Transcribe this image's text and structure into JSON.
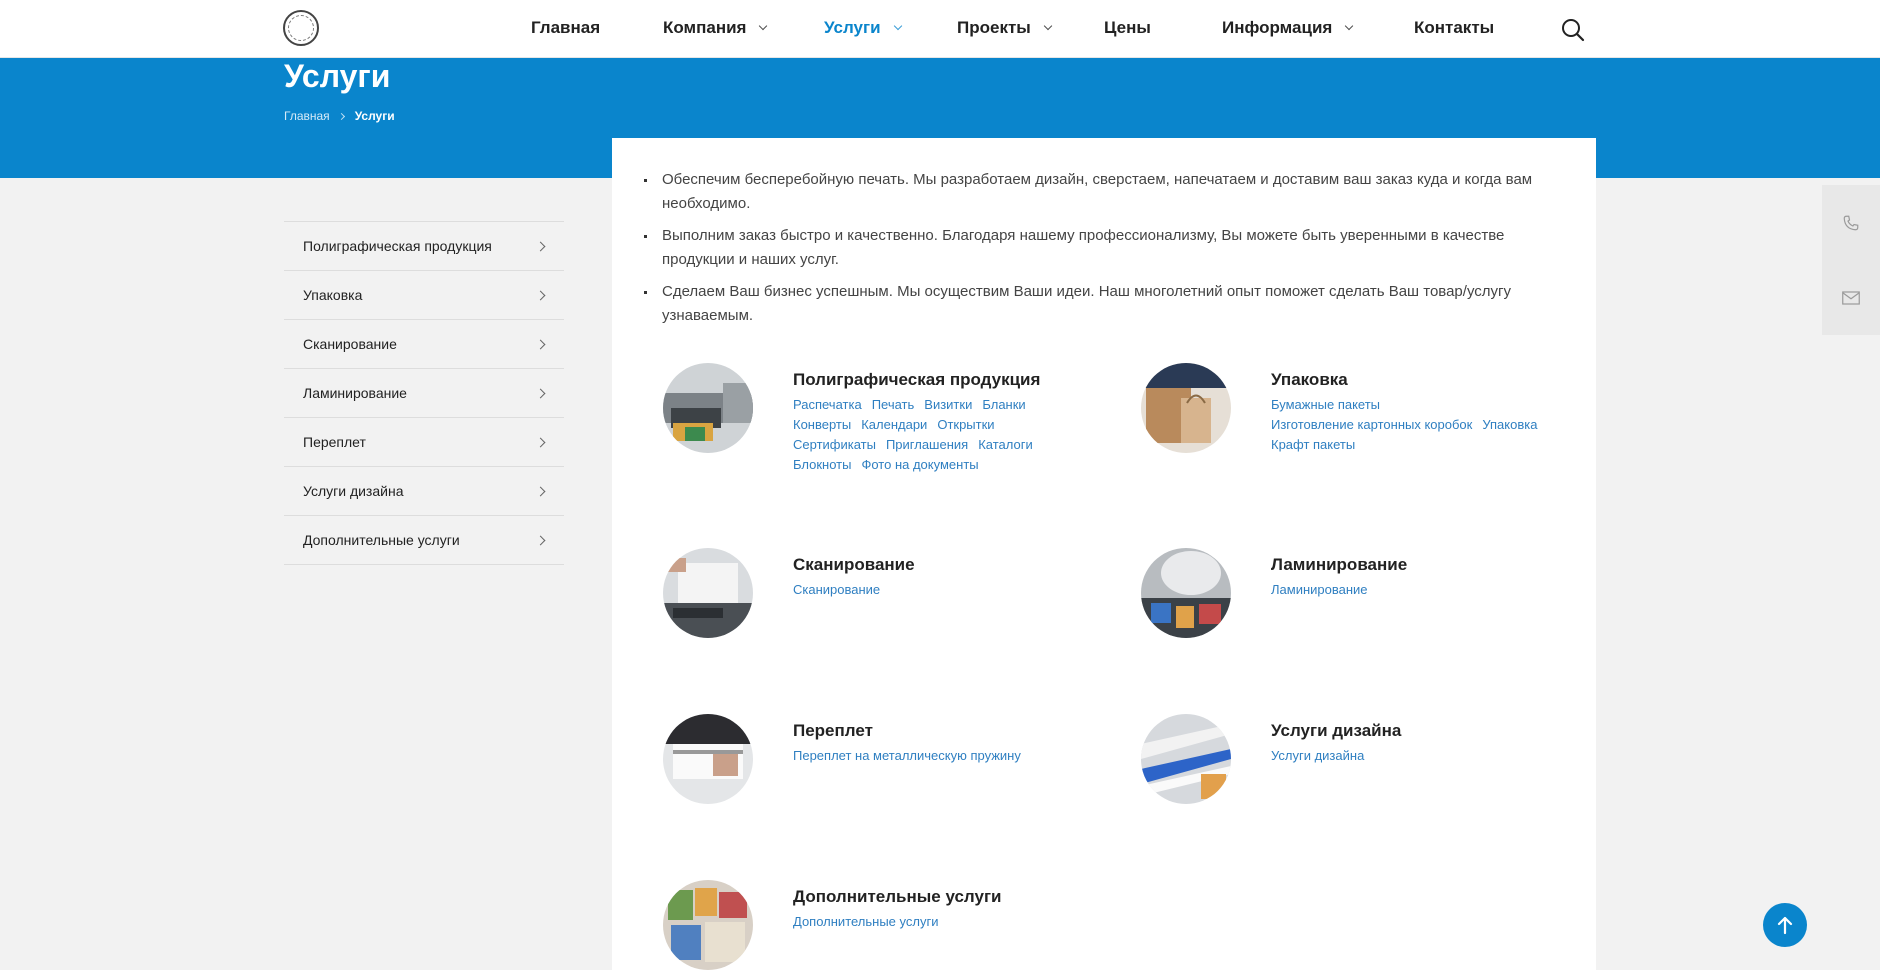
{
  "nav": {
    "items": [
      {
        "label": "Главная",
        "has_dropdown": false,
        "active": false
      },
      {
        "label": "Компания",
        "has_dropdown": true,
        "active": false
      },
      {
        "label": "Услуги",
        "has_dropdown": true,
        "active": true
      },
      {
        "label": "Проекты",
        "has_dropdown": true,
        "active": false
      },
      {
        "label": "Цены",
        "has_dropdown": false,
        "active": false
      },
      {
        "label": "Информация",
        "has_dropdown": true,
        "active": false
      },
      {
        "label": "Контакты",
        "has_dropdown": false,
        "active": false
      }
    ],
    "search_icon": "search-icon"
  },
  "page": {
    "title": "Услуги",
    "breadcrumb": {
      "home": "Главная",
      "current": "Услуги"
    }
  },
  "sidebar": {
    "items": [
      {
        "label": "Полиграфическая продукция"
      },
      {
        "label": "Упаковка"
      },
      {
        "label": "Сканирование"
      },
      {
        "label": "Ламинирование"
      },
      {
        "label": "Переплет"
      },
      {
        "label": "Услуги дизайна"
      },
      {
        "label": "Дополнительные услуги"
      }
    ]
  },
  "intro": {
    "bullets": [
      "Обеспечим бесперебойную печать. Мы разработаем дизайн, сверстаем, напечатаем и доставим ваш заказ куда и когда вам необходимо.",
      "Выполним заказ быстро и качественно. Благодаря нашему профессионализму, Вы можете быть уверенными в качестве продукции и наших услуг.",
      "Сделаем Ваш бизнес успешным. Мы осуществим Ваши идеи. Наш многолетний опыт поможет сделать Ваш товар/услугу узнаваемым."
    ]
  },
  "services": [
    {
      "title": "Полиграфическая продукция",
      "links": [
        "Распечатка",
        "Печать",
        "Визитки",
        "Бланки",
        "Конверты",
        "Календари",
        "Открытки",
        "Сертификаты",
        "Приглашения",
        "Каталоги",
        "Блокноты",
        "Фото на документы"
      ]
    },
    {
      "title": "Упаковка",
      "links": [
        "Бумажные пакеты",
        "Изготовление картонных коробок",
        "Упаковка",
        "Крафт пакеты"
      ]
    },
    {
      "title": "Сканирование",
      "links": [
        "Сканирование"
      ]
    },
    {
      "title": "Ламинирование",
      "links": [
        "Ламинирование"
      ]
    },
    {
      "title": "Переплет",
      "links": [
        "Переплет на металлическую пружину"
      ]
    },
    {
      "title": "Услуги дизайна",
      "links": [
        "Услуги дизайна"
      ]
    },
    {
      "title": "Дополнительные услуги",
      "links": [
        "Дополнительные услуги"
      ]
    }
  ],
  "colors": {
    "accent": "#0a85cc",
    "link": "#2f7fc1",
    "background": "#f2f2f2"
  },
  "floating": {
    "phone_icon": "phone-icon",
    "mail_icon": "mail-icon",
    "to_top_icon": "arrow-up-icon"
  }
}
